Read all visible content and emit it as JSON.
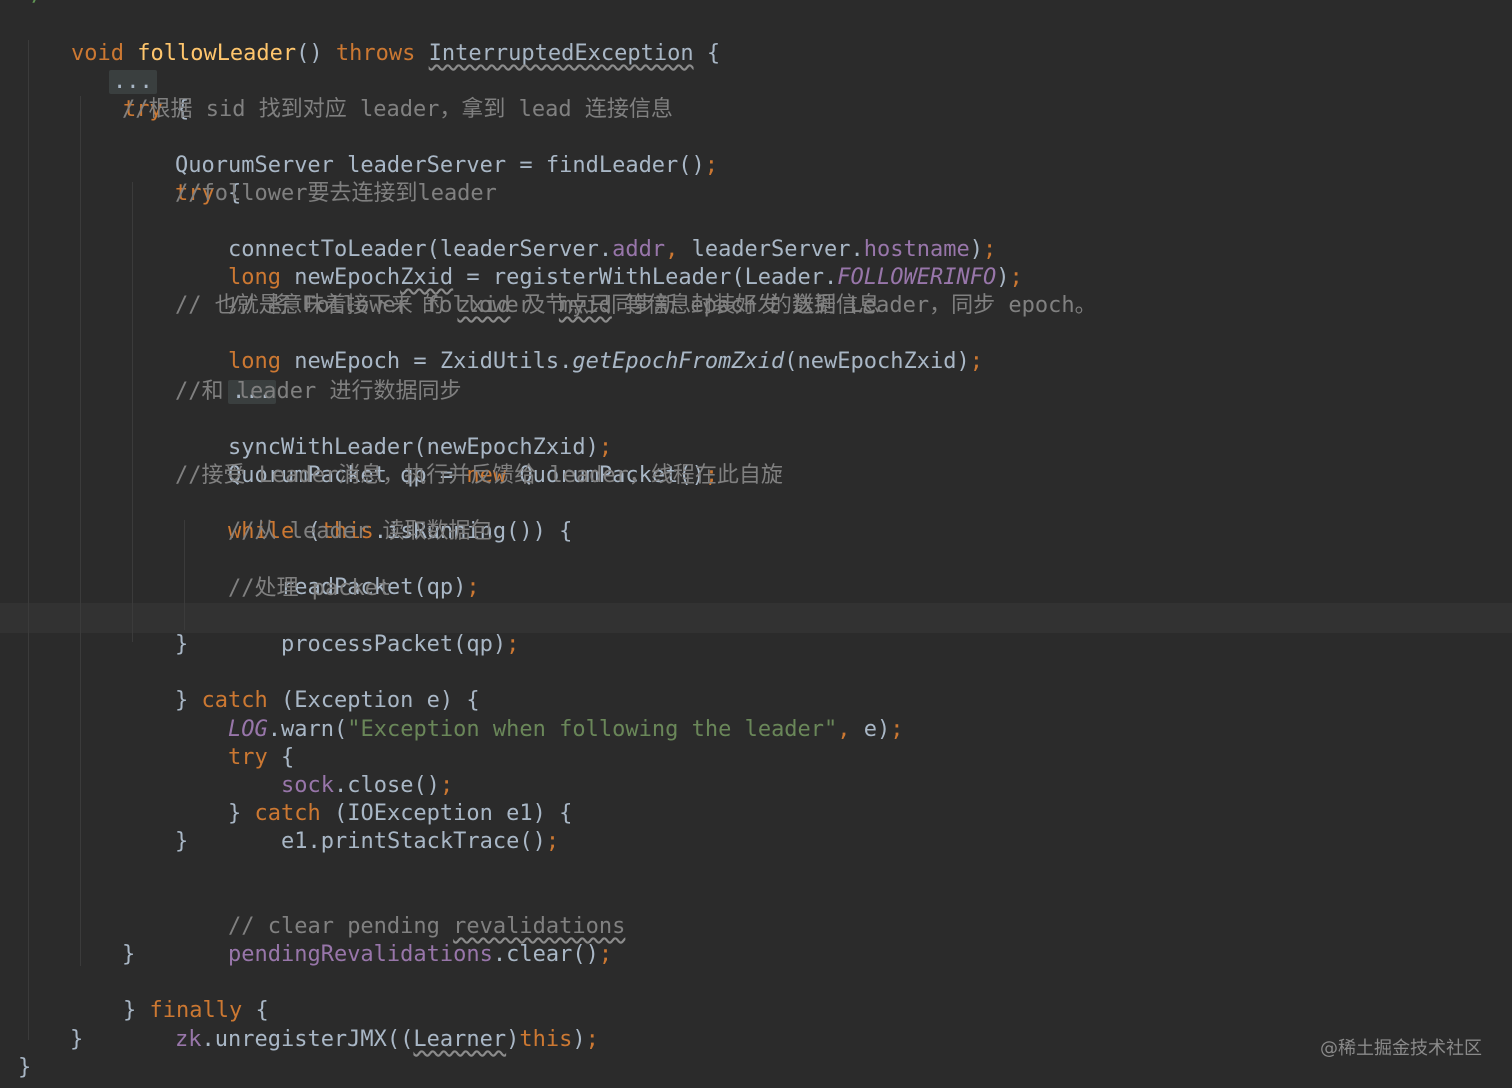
{
  "code": {
    "top_comment_tail": "*/",
    "lines": {
      "l1": [
        "void",
        "followLeader",
        "()",
        "throws",
        "InterruptedException",
        "{"
      ],
      "l2": [
        "..."
      ],
      "l3": [
        "try",
        "{"
      ],
      "l4": "//根据 sid 找到对应 leader，拿到 lead 连接信息",
      "l5": [
        "QuorumServer leaderServer = findLeader()",
        ";"
      ],
      "l6": [
        "try",
        "{"
      ],
      "l7": "//follower要去连接到leader",
      "l8": [
        "connectToLeader(leaderServer.",
        "addr",
        ",",
        " leaderServer.",
        "hostname",
        ")",
        ";"
      ],
      "l9": [
        "long",
        " newEpoch",
        "Zxid",
        " = registerWithLeader(Leader.",
        "FOLLOWERINFO",
        ")",
        ";"
      ],
      "l10": [
        "// 将 Follower 的 ",
        "zxid",
        " 及 ",
        "myid",
        " 等信息封装好发 送到 Leader，同步 epoch。"
      ],
      "l11": "// 也就是意味着接下来 follower 节点只同步新 epoch 的数据信息",
      "l12": [
        "long",
        " newEpoch = ZxidUtils.",
        "getEpochFromZxid",
        "(newEpochZxid)",
        ";"
      ],
      "l13": [
        "..."
      ],
      "l14": "//和 leader 进行数据同步",
      "l15": [
        "syncWithLeader(newEpochZxid)",
        ";"
      ],
      "l16": [
        "QuorumPacket qp = ",
        "new",
        " QuorumPacket()",
        ";"
      ],
      "l17": "//接受 Leader消息，执行并反馈给 leader，线程在此自旋",
      "l18": [
        "while",
        " (",
        "this",
        ".isRunning()) {"
      ],
      "l19": "//从 leader 读取数据包",
      "l20": [
        "readPacket(qp)",
        ";"
      ],
      "l21": "//处理 packet",
      "l22": [
        "processPacket(qp)",
        ";"
      ],
      "l23": "}",
      "l24": [
        "} ",
        "catch",
        " (Exception e) {"
      ],
      "l25": [
        "LOG",
        ".warn(",
        "\"Exception when following the leader\"",
        ",",
        " e)",
        ";"
      ],
      "l26": [
        "try",
        " {"
      ],
      "l27": [
        "sock",
        ".close()",
        ";"
      ],
      "l28": [
        "} ",
        "catch",
        " (IOException e1) {"
      ],
      "l29": [
        "e1.printStackTrace()",
        ";"
      ],
      "l30": "}",
      "l31": [
        "// clear pending ",
        "revalidations"
      ],
      "l32": [
        "pendingRevalidations",
        ".clear()",
        ";"
      ],
      "l33": "}",
      "l34": [
        "} ",
        "finally",
        " {"
      ],
      "l35": [
        "zk",
        ".unregisterJMX((",
        "Learner",
        ")",
        "this",
        ")",
        ";"
      ],
      "l36": "}",
      "l37": "}"
    }
  },
  "watermark": "@稀土掘金技术社区",
  "colors": {
    "background": "#2b2b2b",
    "keyword": "#cc7832",
    "method_decl": "#ffc66d",
    "comment": "#808080",
    "field": "#9876aa",
    "string": "#6a8759",
    "text": "#a9b7c6"
  }
}
